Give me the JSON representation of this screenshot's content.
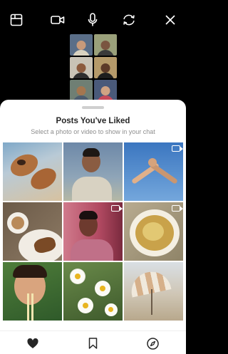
{
  "top_bar": {
    "icons": [
      "gallery-icon",
      "video-camera-icon",
      "microphone-icon",
      "switch-camera-icon",
      "close-icon"
    ]
  },
  "video_call": {
    "participants": 6
  },
  "sheet": {
    "title": "Posts You've Liked",
    "subtitle": "Select a photo or video to show in your chat"
  },
  "photos": [
    {
      "subject": "dogs",
      "video": false
    },
    {
      "subject": "man-portrait",
      "video": false
    },
    {
      "subject": "hands-sky",
      "video": true
    },
    {
      "subject": "coffee-cookie",
      "video": false
    },
    {
      "subject": "man-pink-light",
      "video": true
    },
    {
      "subject": "soup-bowl",
      "video": true
    },
    {
      "subject": "person-eating-noodles",
      "video": false
    },
    {
      "subject": "daisies",
      "video": false
    },
    {
      "subject": "beach-umbrella",
      "video": false
    }
  ],
  "bottom_bar": {
    "icons": [
      "heart-icon",
      "bookmark-icon",
      "compass-icon"
    ],
    "active": "heart-icon"
  },
  "colors": {
    "background": "#000000",
    "sheet": "#ffffff",
    "title": "#262626",
    "subtitle": "#8e8e8e"
  }
}
